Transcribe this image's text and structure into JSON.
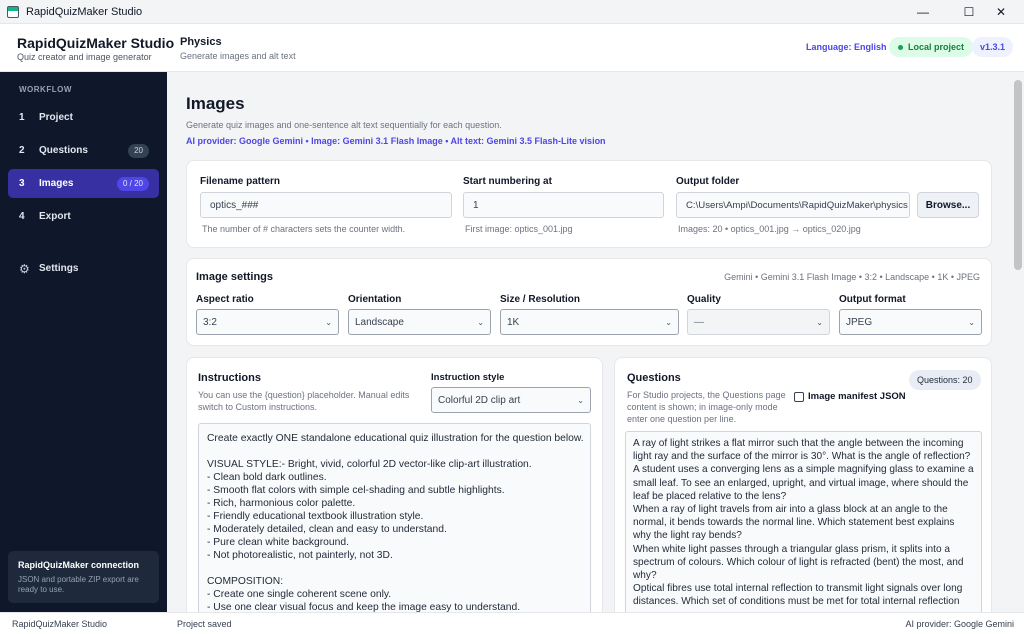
{
  "window": {
    "title": "RapidQuizMaker Studio",
    "minimize": "—",
    "maximize": "☐",
    "close": "✕"
  },
  "header": {
    "brand_title": "RapidQuizMaker Studio",
    "brand_sub": "Quiz creator and image generator",
    "project_title": "Physics",
    "project_sub": "Generate images and alt text",
    "language": "Language: English",
    "local_project": "Local project",
    "version": "v1.3.1"
  },
  "sidebar": {
    "section_label": "WORKFLOW",
    "items": [
      {
        "num": "1",
        "label": "Project",
        "badge": ""
      },
      {
        "num": "2",
        "label": "Questions",
        "badge": "20"
      },
      {
        "num": "3",
        "label": "Images",
        "badge": "0 / 20"
      },
      {
        "num": "4",
        "label": "Export",
        "badge": ""
      }
    ],
    "settings_label": "Settings",
    "connection_title": "RapidQuizMaker connection",
    "connection_desc": "JSON and portable ZIP export are ready to use."
  },
  "page": {
    "title": "Images",
    "description": "Generate quiz images and one-sentence alt text sequentially for each question.",
    "provider": "AI provider: Google Gemini • Image: Gemini 3.1 Flash Image • Alt text: Gemini 3.5 Flash-Lite vision"
  },
  "files": {
    "pattern_label": "Filename pattern",
    "pattern_value": "optics_###",
    "pattern_hint": "The number of # characters sets the counter width.",
    "start_label": "Start numbering at",
    "start_value": "1",
    "start_hint": "First image: optics_001.jpg",
    "folder_label": "Output folder",
    "folder_value": "C:\\Users\\Ampi\\Documents\\RapidQuizMaker\\physics",
    "folder_hint": "Images: 20 • optics_001.jpg → optics_020.jpg",
    "browse_label": "Browse..."
  },
  "image_settings": {
    "title": "Image settings",
    "summary": "Gemini • Gemini 3.1 Flash Image • 3:2 • Landscape • 1K • JPEG",
    "aspect_label": "Aspect ratio",
    "aspect_value": "3:2",
    "orientation_label": "Orientation",
    "orientation_value": "Landscape",
    "size_label": "Size / Resolution",
    "size_value": "1K",
    "quality_label": "Quality",
    "quality_value": "—",
    "format_label": "Output format",
    "format_value": "JPEG"
  },
  "instructions": {
    "title": "Instructions",
    "description": "You can use the {question} placeholder. Manual edits switch to Custom instructions.",
    "style_label": "Instruction style",
    "style_value": "Colorful 2D clip art",
    "lines": [
      "Create exactly ONE standalone educational quiz illustration for the question below.",
      "",
      "VISUAL STYLE:- Bright, vivid, colorful 2D vector-like clip-art illustration.",
      "- Clean bold dark outlines.",
      "- Smooth flat colors with simple cel-shading and subtle highlights.",
      "- Rich, harmonious color palette.",
      "- Friendly educational textbook illustration style.",
      "- Moderately detailed, clean and easy to understand.",
      "- Pure clean white background.",
      "- Not photorealistic, not painterly, not 3D.",
      "",
      "COMPOSITION:",
      "- Create one single coherent scene only.",
      "- Use one clear visual focus and keep the image easy to understand."
    ]
  },
  "questions": {
    "title": "Questions",
    "description": "For Studio projects, the Questions page content is shown; in image-only mode enter one question per line.",
    "manifest_label": "Image manifest JSON",
    "count_badge": "Questions: 20",
    "lines": [
      "A ray of light strikes a flat mirror such that the angle between the incoming",
      "light ray and the surface of the mirror is 30°. What is the angle of reflection?",
      "A student uses a converging lens as a simple magnifying glass to examine a",
      "small leaf. To see an enlarged, upright, and virtual image, where should the",
      "leaf be placed relative to the lens?",
      "When a ray of light travels from air into a glass block at an angle to the",
      "normal, it bends towards the normal line. Which statement best explains",
      "why the light ray bends?",
      "When white light passes through a triangular glass prism, it splits into a",
      "spectrum of colours. Which colour of light is refracted (bent) the most, and",
      "why?",
      "Optical fibres use total internal reflection to transmit light signals over long",
      "distances. Which set of conditions must be met for total internal reflection"
    ]
  },
  "status": {
    "app": "RapidQuizMaker Studio",
    "message": "Project saved",
    "provider": "AI provider: Google Gemini"
  }
}
